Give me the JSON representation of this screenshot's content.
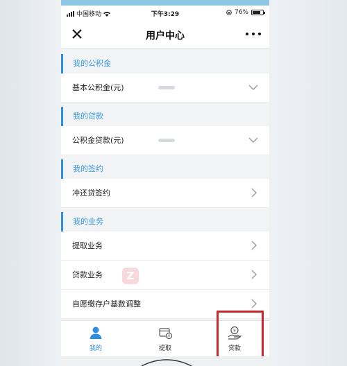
{
  "status_bar": {
    "carrier": "中国移动",
    "time": "下午3:29",
    "battery": "76%",
    "battery_level": 0.76
  },
  "navbar": {
    "title": "用户中心"
  },
  "sections": [
    {
      "header": "我的公积金",
      "rows": [
        {
          "label": "基本公积金(元)",
          "control": "chevron-down"
        }
      ]
    },
    {
      "header": "我的贷款",
      "rows": [
        {
          "label": "公积金贷款(元)",
          "control": "chevron-down"
        }
      ]
    },
    {
      "header": "我的签约",
      "rows": [
        {
          "label": "冲还贷签约",
          "control": "chevron-right"
        }
      ]
    },
    {
      "header": "我的业务",
      "rows": [
        {
          "label": "提取业务",
          "control": "chevron-right"
        },
        {
          "label": "贷款业务",
          "control": "chevron-right"
        },
        {
          "label": "自愿缴存户基数调整",
          "control": "chevron-right"
        }
      ]
    }
  ],
  "tabbar": {
    "tabs": [
      {
        "label": "我的",
        "icon": "person-icon",
        "active": true
      },
      {
        "label": "提取",
        "icon": "withdraw-icon",
        "active": false
      },
      {
        "label": "贷款",
        "icon": "loan-icon",
        "active": false
      }
    ]
  },
  "colors": {
    "accent": "#2d8fe0",
    "section_text": "#3b9ae0",
    "highlight": "#c9272c"
  }
}
